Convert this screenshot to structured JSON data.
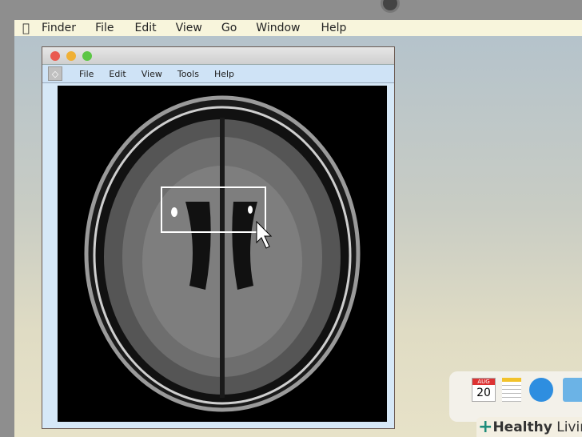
{
  "system_menu": {
    "app": "Finder",
    "items": [
      "File",
      "Edit",
      "View",
      "Go",
      "Window",
      "Help"
    ]
  },
  "window": {
    "menu": [
      "File",
      "Edit",
      "View",
      "Tools",
      "Help"
    ],
    "traffic_lights": {
      "close": "#e95a50",
      "minimize": "#f0b035",
      "zoom": "#5cc645"
    }
  },
  "dock": {
    "calendar_month": "AUG",
    "calendar_day": "20",
    "icons": [
      "calendar-icon",
      "notes-icon",
      "messages-icon",
      "downloads-folder-icon"
    ]
  },
  "branding": {
    "bold": "Healthy",
    "light": " Living"
  }
}
